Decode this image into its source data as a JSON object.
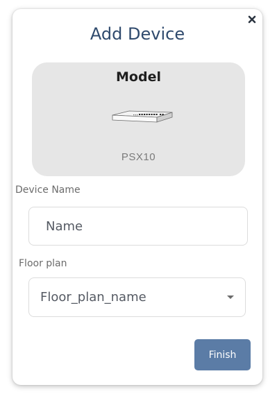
{
  "dialog": {
    "title": "Add Device",
    "close_icon": "close-icon"
  },
  "model": {
    "heading": "Model",
    "name": "PSX10",
    "image_icon": "network-switch-icon"
  },
  "device_name": {
    "label": "Device Name",
    "placeholder": "Name",
    "value": ""
  },
  "floor_plan": {
    "label": "Floor plan",
    "selected": "Floor_plan_name",
    "caret_icon": "chevron-down-icon"
  },
  "actions": {
    "finish_label": "Finish"
  },
  "colors": {
    "accent": "#5b7ca6",
    "title": "#2f4a6d",
    "card_background": "#e6e6e6"
  }
}
